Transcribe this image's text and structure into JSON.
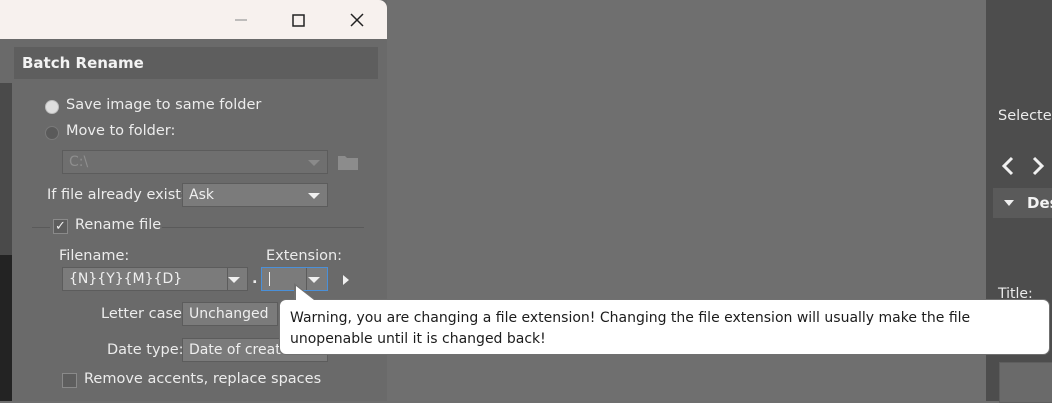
{
  "dialog": {
    "header": "Batch Rename",
    "save_same_folder": "Save image to same folder",
    "move_to_folder": "Move to folder:",
    "folder_path": "C:\\",
    "if_exists_label": "If file already exists:",
    "if_exists_value": "Ask",
    "rename_file_label": "Rename file",
    "filename_label": "Filename:",
    "filename_value": "{N}{Y}{M}{D}",
    "extension_label": "Extension:",
    "extension_value": "",
    "dot": ".",
    "letter_case_label": "Letter case:",
    "letter_case_value": "Unchanged",
    "date_type_label": "Date type:",
    "date_type_value": "Date of creati",
    "remove_accents_label": "Remove accents, replace spaces"
  },
  "tooltip": {
    "text": "Warning, you are changing a file extension! Changing the file extension will usually make the file unopenable until it is changed back!"
  },
  "right_panel": {
    "selected": "Selectec",
    "section": "Des",
    "title_label": "Title:"
  },
  "colors": {
    "dialog_bg": "#6a6a6a",
    "titlebar_bg": "#f7f1ee",
    "focus_border": "#4a90d9"
  }
}
